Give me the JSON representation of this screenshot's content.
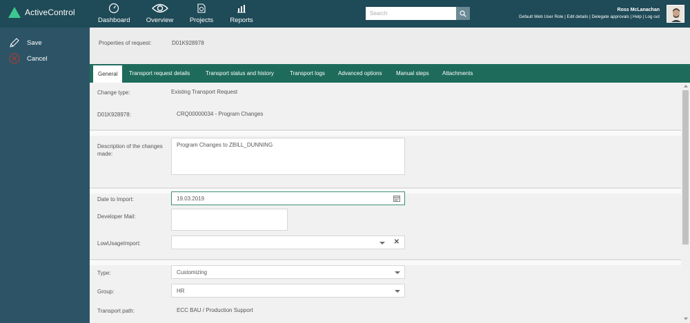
{
  "app": {
    "name": "ActiveControl"
  },
  "nav": [
    {
      "label": "Dashboard",
      "icon": "gauge-icon"
    },
    {
      "label": "Overview",
      "icon": "eye-icon"
    },
    {
      "label": "Projects",
      "icon": "projects-icon"
    },
    {
      "label": "Reports",
      "icon": "chart-icon"
    }
  ],
  "search": {
    "placeholder": "Search",
    "icon": "search-icon"
  },
  "user": {
    "name": "Ross McLanachan",
    "links": "Default Web User Role | Edit details | Delegate approvals | Help | Log out"
  },
  "sidebar": {
    "save": "Save",
    "cancel": "Cancel"
  },
  "properties": {
    "label": "Properties of request:",
    "value": "D01K928978"
  },
  "tabs": [
    "General",
    "Transport request details",
    "Transport status and history",
    "Transport logs",
    "Advanced options",
    "Manual steps",
    "Attachments"
  ],
  "form": {
    "change_type_label": "Change type:",
    "change_type_value": "Existing Transport Request",
    "request_label": "D01K928978:",
    "request_value": "CRQ00000034 - Program Changes",
    "description_label": "Description of the changes made:",
    "description_value": "Program Changes to ZBILL_DUNNING",
    "date_label": "Date to Import:",
    "date_value": "19.03.2019",
    "dev_mail_label": "Developer Mail:",
    "dev_mail_value": "",
    "low_usage_label": "LowUsageImport:",
    "low_usage_value": "",
    "type_label": "Type:",
    "type_value": "Customizing",
    "group_label": "Group:",
    "group_value": "HR",
    "path_label": "Transport path:",
    "path_value": "ECC BAU / Production Support"
  },
  "colors": {
    "topbar": "#1f4a57",
    "sidebar": "#2d5466",
    "tabbar": "#1e6b5c",
    "accent": "#3cc890"
  }
}
